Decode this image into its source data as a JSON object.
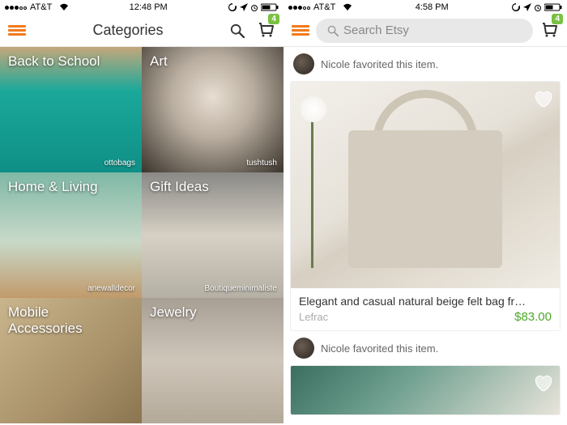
{
  "left": {
    "status": {
      "carrier": "AT&T",
      "time": "12:48 PM"
    },
    "header": {
      "title": "Categories",
      "cart_badge": "4"
    },
    "tiles": [
      {
        "label": "Back to School",
        "credit": "ottobags"
      },
      {
        "label": "Art",
        "credit": "tushtush"
      },
      {
        "label": "Home & Living",
        "credit": "anewalldecor"
      },
      {
        "label": "Gift Ideas",
        "credit": "Boutiqueminimaliste"
      },
      {
        "label": "Mobile Accessories",
        "credit": ""
      },
      {
        "label": "Jewelry",
        "credit": ""
      }
    ]
  },
  "right": {
    "status": {
      "carrier": "AT&T",
      "time": "4:58 PM"
    },
    "header": {
      "search_placeholder": "Search Etsy",
      "cart_badge": "4"
    },
    "feed": [
      {
        "activity": "Nicole favorited this item.",
        "title": "Elegant and casual natural beige felt bag fr…",
        "seller": "Lefrac",
        "price": "$83.00"
      },
      {
        "activity": "Nicole favorited this item."
      }
    ]
  }
}
